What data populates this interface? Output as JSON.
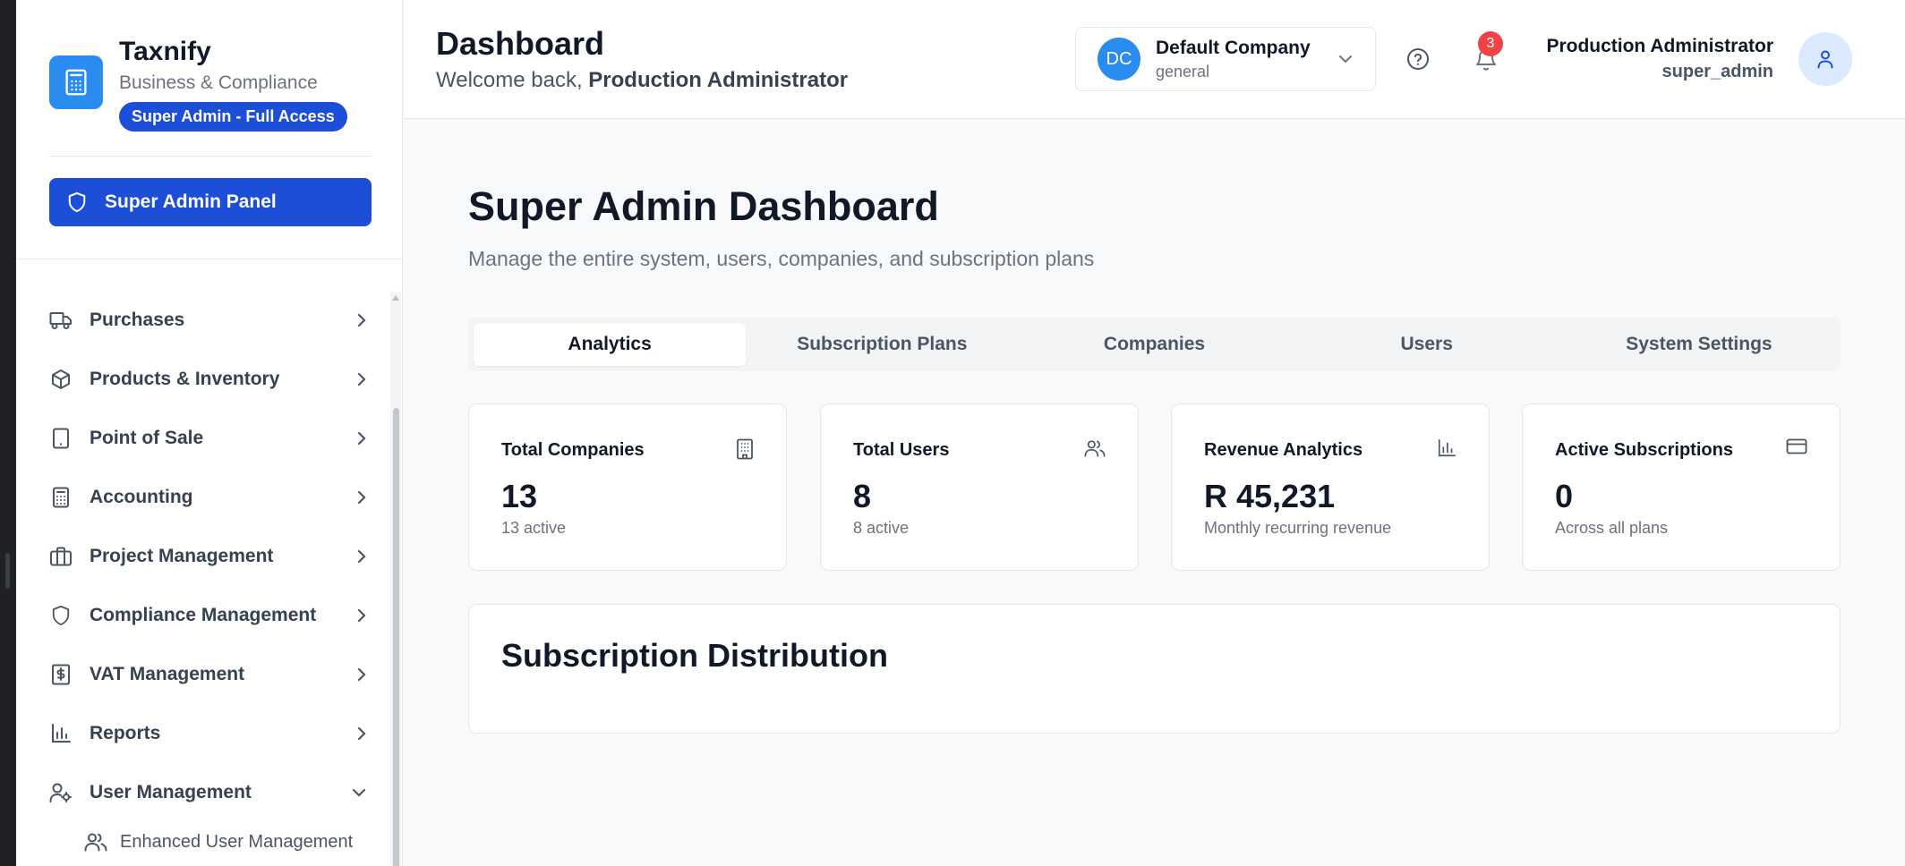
{
  "brand": {
    "name": "Taxnify",
    "subtitle": "Business & Compliance",
    "badge": "Super Admin - Full Access"
  },
  "sidebar": {
    "admin_panel_label": "Super Admin Panel",
    "items": [
      {
        "label": "Purchases",
        "icon": "truck-icon"
      },
      {
        "label": "Products & Inventory",
        "icon": "package-icon"
      },
      {
        "label": "Point of Sale",
        "icon": "tablet-icon"
      },
      {
        "label": "Accounting",
        "icon": "calculator-icon"
      },
      {
        "label": "Project Management",
        "icon": "briefcase-icon"
      },
      {
        "label": "Compliance Management",
        "icon": "shield-icon"
      },
      {
        "label": "VAT Management",
        "icon": "receipt-icon"
      },
      {
        "label": "Reports",
        "icon": "bar-chart-icon"
      },
      {
        "label": "User Management",
        "icon": "user-cog-icon",
        "expanded": true
      }
    ],
    "sub_items": [
      {
        "label": "Enhanced User Management",
        "icon": "users-icon"
      }
    ]
  },
  "header": {
    "title": "Dashboard",
    "welcome_prefix": "Welcome back,",
    "welcome_name": "Production Administrator",
    "company": {
      "initials": "DC",
      "name": "Default Company",
      "type": "general"
    },
    "notification_count": "3",
    "user": {
      "name": "Production Administrator",
      "role": "super_admin"
    }
  },
  "main": {
    "title": "Super Admin Dashboard",
    "subtitle": "Manage the entire system, users, companies, and subscription plans",
    "tabs": [
      {
        "label": "Analytics",
        "active": true
      },
      {
        "label": "Subscription Plans",
        "active": false
      },
      {
        "label": "Companies",
        "active": false
      },
      {
        "label": "Users",
        "active": false
      },
      {
        "label": "System Settings",
        "active": false
      }
    ],
    "cards": [
      {
        "label": "Total Companies",
        "value": "13",
        "note": "13 active",
        "icon": "building-icon"
      },
      {
        "label": "Total Users",
        "value": "8",
        "note": "8 active",
        "icon": "users-icon"
      },
      {
        "label": "Revenue Analytics",
        "value": "R 45,231",
        "note": "Monthly recurring revenue",
        "icon": "bar-chart-icon"
      },
      {
        "label": "Active Subscriptions",
        "value": "0",
        "note": "Across all plans",
        "icon": "credit-card-icon"
      }
    ],
    "distribution_title": "Subscription Distribution"
  },
  "colors": {
    "accent": "#1d4ed8",
    "brand_blue": "#2b8cf0",
    "badge_red": "#ef4444"
  }
}
